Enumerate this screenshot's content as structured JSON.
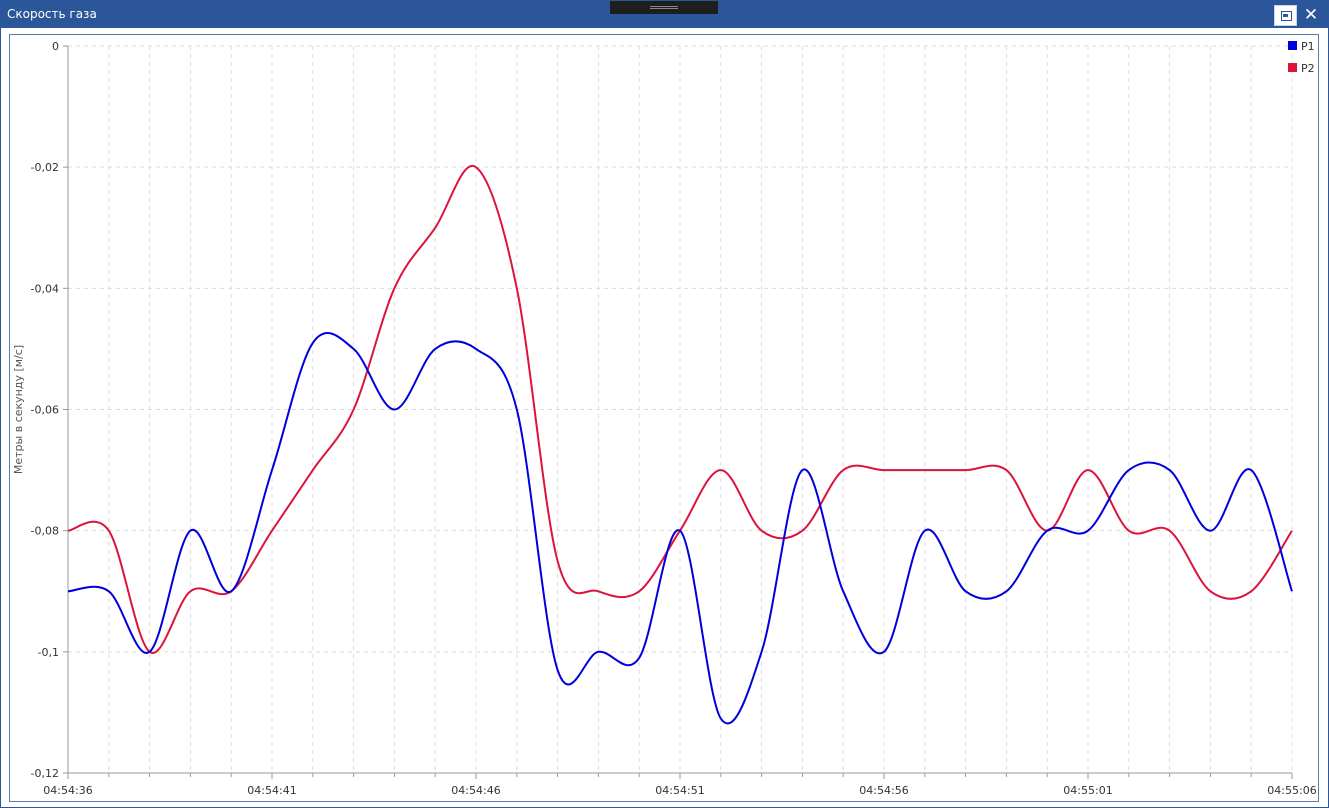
{
  "window": {
    "title": "Скорость газа"
  },
  "chart_data": {
    "type": "line",
    "title": "",
    "ylabel": "Метры в секунду [м/с]",
    "xlabel": "",
    "ylim": [
      -0.12,
      0
    ],
    "xlim_seconds": [
      0,
      30
    ],
    "yticks": [
      0,
      -0.02,
      -0.04,
      -0.06,
      -0.08,
      -0.1,
      -0.12
    ],
    "ytick_labels": [
      "0",
      "-0,02",
      "-0,04",
      "-0,06",
      "-0,08",
      "-0,1",
      "-0,12"
    ],
    "xticks_seconds": [
      0,
      5,
      10,
      15,
      20,
      25,
      30
    ],
    "xtick_labels": [
      "04:54:36",
      "04:54:41",
      "04:54:46",
      "04:54:51",
      "04:54:56",
      "04:55:01",
      "04:55:06"
    ],
    "grid": true,
    "legend_position": "top-right",
    "series": [
      {
        "name": "P1",
        "color": "#0000dd",
        "x": [
          0,
          1,
          2,
          3,
          4,
          5,
          6,
          7,
          8,
          9,
          10,
          11,
          12,
          13,
          14,
          15,
          16,
          17,
          18,
          19,
          20,
          21,
          22,
          23,
          24,
          25,
          26,
          27,
          28,
          29,
          30
        ],
        "values": [
          -0.09,
          -0.09,
          -0.1,
          -0.08,
          -0.09,
          -0.07,
          -0.049,
          -0.05,
          -0.06,
          -0.05,
          -0.05,
          -0.06,
          -0.103,
          -0.1,
          -0.101,
          -0.08,
          -0.111,
          -0.1,
          -0.07,
          -0.09,
          -0.1,
          -0.08,
          -0.09,
          -0.09,
          -0.08,
          -0.08,
          -0.07,
          -0.07,
          -0.08,
          -0.07,
          -0.09
        ]
      },
      {
        "name": "P2",
        "color": "#dc143c",
        "x": [
          0,
          1,
          2,
          3,
          4,
          5,
          6,
          7,
          8,
          9,
          10,
          11,
          12,
          13,
          14,
          15,
          16,
          17,
          18,
          19,
          20,
          21,
          22,
          23,
          24,
          25,
          26,
          27,
          28,
          29,
          30
        ],
        "values": [
          -0.08,
          -0.08,
          -0.1,
          -0.09,
          -0.09,
          -0.08,
          -0.07,
          -0.06,
          -0.04,
          -0.03,
          -0.02,
          -0.04,
          -0.085,
          -0.09,
          -0.09,
          -0.08,
          -0.07,
          -0.08,
          -0.08,
          -0.07,
          -0.07,
          -0.07,
          -0.07,
          -0.07,
          -0.08,
          -0.07,
          -0.08,
          -0.08,
          -0.09,
          -0.09,
          -0.08
        ]
      }
    ]
  }
}
